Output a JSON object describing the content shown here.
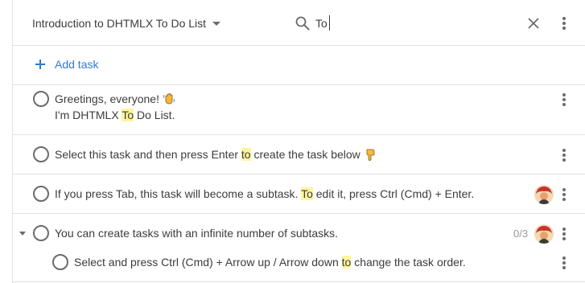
{
  "header": {
    "project_title": "Introduction to DHTMLX To Do List",
    "search_value": "To",
    "icons": {
      "dropdown": "caret-down-icon",
      "search": "search-icon",
      "clear": "close-icon",
      "menu": "more-vertical-icon"
    }
  },
  "add_task": {
    "label": "Add task",
    "icon": "plus-icon"
  },
  "highlight_color": "#fff59d",
  "accent_color": "#2d7ad6",
  "tasks": [
    {
      "segments": [
        "Greetings, everyone!"
      ],
      "emoji": "waving-hand-icon",
      "line2": [
        "I'm DHTMLX ",
        "To",
        " Do List."
      ]
    },
    {
      "segments": [
        "Select this task and then press Enter ",
        "to",
        " create the task below"
      ],
      "emoji": "pointing-down-hand-icon"
    },
    {
      "segments": [
        "If you press Tab, this task will become a subtask. ",
        "To",
        " edit it, press Ctrl (Cmd) + Enter."
      ],
      "assignee": "avatar"
    },
    {
      "segments": [
        "You can create tasks with an infinite number of subtasks."
      ],
      "counter": "0/3",
      "assignee": "avatar",
      "expanded": true
    },
    {
      "segments": [
        "Select and press Ctrl (Cmd) + Arrow up / Arrow down ",
        "to",
        " change the task order."
      ],
      "subtask": true
    }
  ]
}
